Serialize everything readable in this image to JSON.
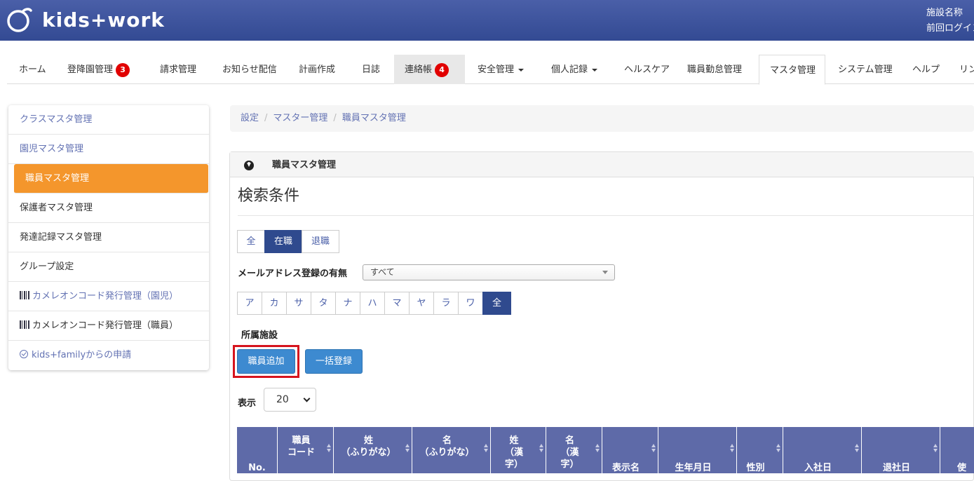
{
  "header": {
    "logo_text": "kids+work",
    "facility_label": "施設名称",
    "last_login_label": "前回ログイン"
  },
  "nav": {
    "items": [
      {
        "label": "ホーム"
      },
      {
        "label": "登降園管理",
        "badge": "3"
      },
      {
        "label": "請求管理"
      },
      {
        "label": "お知らせ配信"
      },
      {
        "label": "計画作成"
      },
      {
        "label": "日誌"
      },
      {
        "label": "連絡帳",
        "badge": "4"
      },
      {
        "label": "安全管理"
      },
      {
        "label": "個人記録"
      },
      {
        "label": "ヘルスケア"
      },
      {
        "label": "職員勤怠管理"
      },
      {
        "label": "マスタ管理"
      },
      {
        "label": "システム管理"
      },
      {
        "label": "ヘルプ"
      },
      {
        "label": "リン"
      }
    ]
  },
  "sidebar": {
    "items": [
      {
        "label": "クラスマスタ管理"
      },
      {
        "label": "園児マスタ管理"
      },
      {
        "label": "職員マスタ管理"
      },
      {
        "label": "保護者マスタ管理"
      },
      {
        "label": "発達記録マスタ管理"
      },
      {
        "label": "グループ設定"
      },
      {
        "label": "カメレオンコード発行管理（園児）"
      },
      {
        "label": "カメレオンコード発行管理（職員）"
      },
      {
        "label": "kids+familyからの申請"
      }
    ]
  },
  "breadcrumb": [
    "設定",
    "マスター管理",
    "職員マスタ管理"
  ],
  "panel": {
    "title": "職員マスタ管理",
    "search_title": "検索条件",
    "status_filter": [
      "全",
      "在職",
      "退職"
    ],
    "status_selected": "在職",
    "mail_label": "メールアドレス登録の有無",
    "mail_value": "すべて",
    "kana_filter": [
      "ア",
      "カ",
      "サ",
      "タ",
      "ナ",
      "ハ",
      "マ",
      "ヤ",
      "ラ",
      "ワ",
      "全"
    ],
    "kana_selected": "全",
    "facility_label": "所属施設",
    "add_button": "職員追加",
    "bulk_button": "一括登録",
    "page_size_label": "表示",
    "page_size_value": "20"
  },
  "table": {
    "columns": [
      "No.",
      "職員\nコード",
      "姓\n（ふりがな）",
      "名\n（ふりがな）",
      "姓\n（漢\n字）",
      "名\n（漢\n字）",
      "表示名",
      "生年月日",
      "性別",
      "入社日",
      "退社日",
      "使"
    ]
  }
}
